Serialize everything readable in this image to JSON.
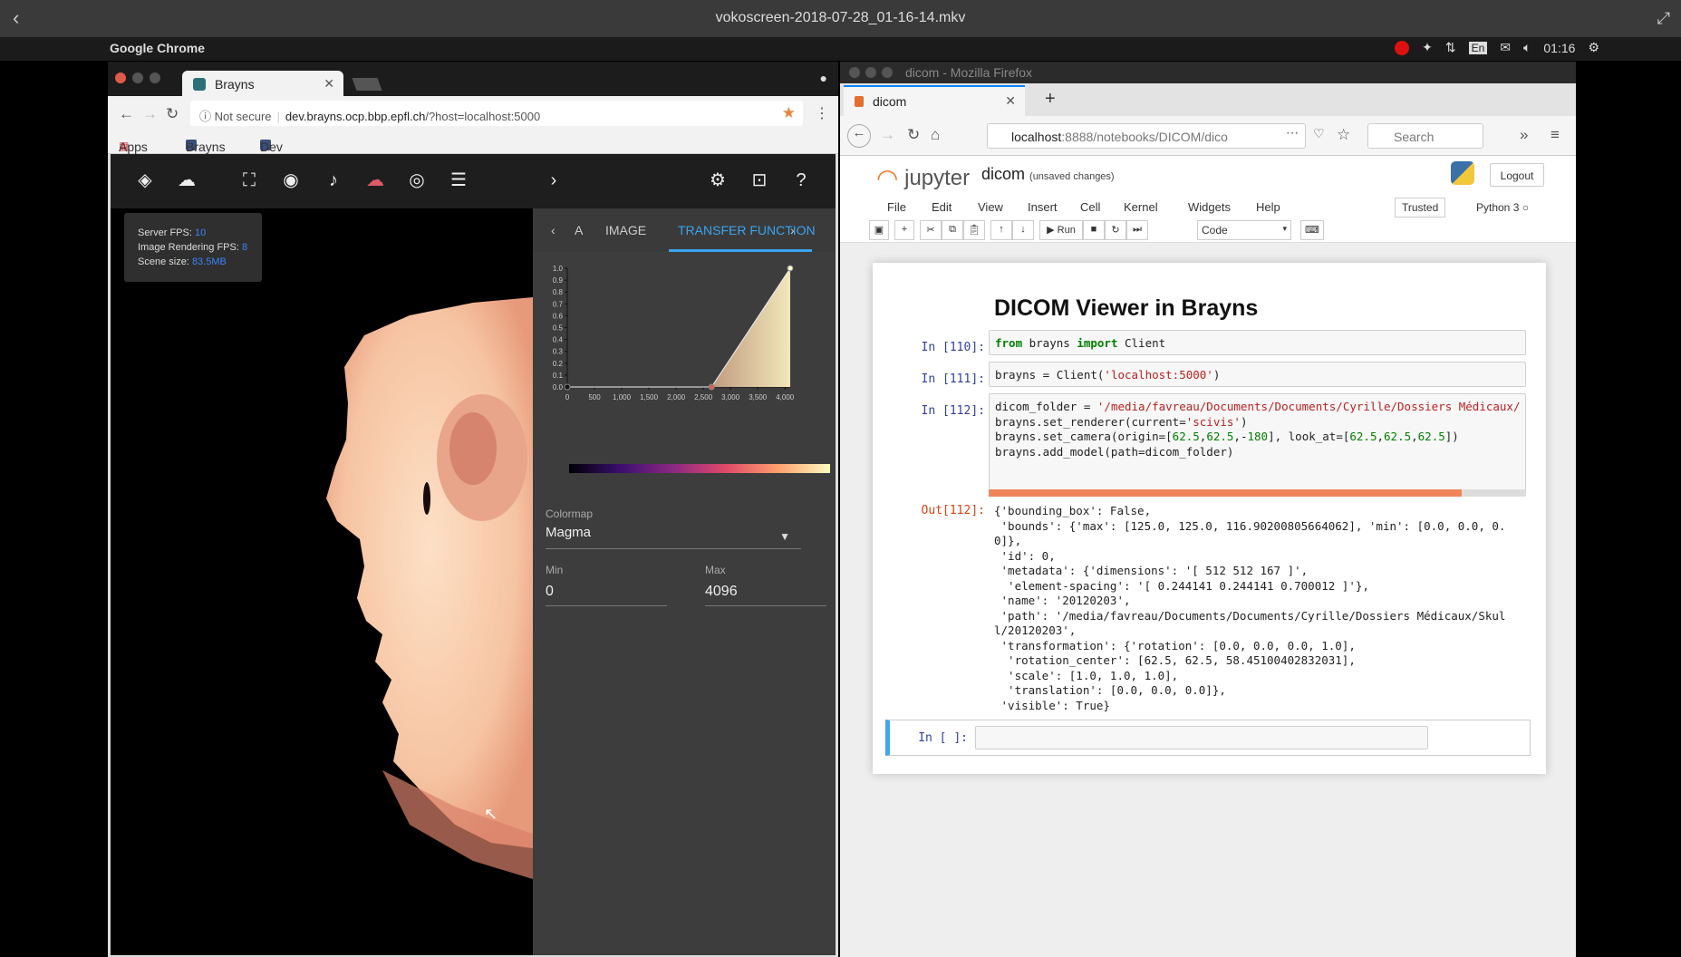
{
  "player": {
    "title": "vokoscreen-2018-07-28_01-16-14.mkv"
  },
  "topbar": {
    "app": "Google Chrome",
    "lang": "En",
    "time": "01:16"
  },
  "chrome": {
    "tab_title": "Brayns",
    "secure_label": "Not secure",
    "url_host": "dev.brayns.ocp.bbp.epfl.ch",
    "url_path": "/?host=localhost:5000",
    "bookmarks": [
      "Apps",
      "Brayns",
      "Dev"
    ]
  },
  "brayns": {
    "stats": {
      "server_fps_label": "Server FPS:",
      "server_fps": "10",
      "image_fps_label": "Image Rendering FPS:",
      "image_fps": "8",
      "scene_size_label": "Scene size:",
      "scene_size": "83.5MB"
    },
    "tabs": [
      "A",
      "IMAGE",
      "TRANSFER FUNCTION"
    ],
    "active_tab": "TRANSFER FUNCTION",
    "colormap_label": "Colormap",
    "colormap_value": "Magma",
    "min_label": "Min",
    "min_value": "0",
    "max_label": "Max",
    "max_value": "4096",
    "accent": "#3aa4f0"
  },
  "chart_data": {
    "type": "area",
    "x_ticks": [
      "0",
      "500",
      "1,000",
      "1,500",
      "2,000",
      "2,500",
      "3,000",
      "3,500",
      "4,000"
    ],
    "y_ticks": [
      "0.0",
      "0.1",
      "0.2",
      "0.3",
      "0.4",
      "0.5",
      "0.6",
      "0.7",
      "0.8",
      "0.9",
      "1.0"
    ],
    "xlim": [
      0,
      4096
    ],
    "ylim": [
      0,
      1
    ],
    "points": [
      {
        "x": 0,
        "y": 0
      },
      {
        "x": 2650,
        "y": 0
      },
      {
        "x": 4096,
        "y": 1
      }
    ],
    "colormap": "Magma"
  },
  "firefox": {
    "window_title": "dicom - Mozilla Firefox",
    "tab_title": "dicom",
    "url_host": "localhost",
    "url_path": ":8888/notebooks/DICOM/dico",
    "search_placeholder": "Search"
  },
  "jupyter": {
    "notebook_name": "dicom",
    "status": "(unsaved changes)",
    "logout": "Logout",
    "menu": [
      "File",
      "Edit",
      "View",
      "Insert",
      "Cell",
      "Kernel",
      "Widgets",
      "Help"
    ],
    "trusted": "Trusted",
    "kernel": "Python 3",
    "run_label": "Run",
    "cell_type": "Code",
    "title": "DICOM Viewer in Brayns",
    "prompts": [
      "In [110]:",
      "In [111]:",
      "In [112]:",
      "Out[112]:",
      "In [ ]:"
    ],
    "output_lines": [
      "{'bounding_box': False,",
      " 'bounds': {'max': [125.0, 125.0, 116.90200805664062], 'min': [0.0, 0.0, 0.",
      "0]},",
      " 'id': 0,",
      " 'metadata': {'dimensions': '[ 512 512 167 ]',",
      "  'element-spacing': '[ 0.244141 0.244141 0.700012 ]'},",
      " 'name': '20120203',",
      " 'path': '/media/favreau/Documents/Documents/Cyrille/Dossiers Médicaux/Skul",
      "l/20120203',",
      " 'transformation': {'rotation': [0.0, 0.0, 0.0, 1.0],",
      "  'rotation_center': [62.5, 62.5, 58.45100402832031],",
      "  'scale': [1.0, 1.0, 1.0],",
      "  'translation': [0.0, 0.0, 0.0]},",
      " 'visible': True}"
    ]
  }
}
